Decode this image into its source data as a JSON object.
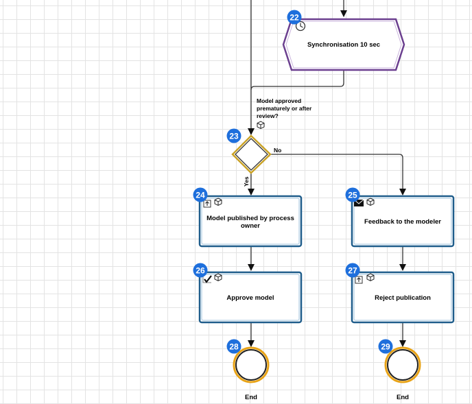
{
  "nodes": {
    "sync": {
      "number": "22",
      "label": "Synchronisation 10 sec",
      "icon": "clock-icon"
    },
    "gateway": {
      "number": "23",
      "label_lines": [
        "Model approved",
        "prematurely or after",
        "review?"
      ],
      "icon": "cube-icon"
    },
    "publish": {
      "number": "24",
      "label_lines": [
        "Model published by process",
        "owner"
      ],
      "icons": [
        "upload-icon",
        "cube-icon"
      ]
    },
    "feedback": {
      "number": "25",
      "label": "Feedback to the modeler",
      "icons": [
        "envelope-icon",
        "cube-icon"
      ]
    },
    "approve": {
      "number": "26",
      "label": "Approve model",
      "icons": [
        "check-icon",
        "cube-icon"
      ]
    },
    "reject": {
      "number": "27",
      "label": "Reject publication",
      "icons": [
        "upload-icon",
        "cube-icon"
      ]
    },
    "end_left": {
      "number": "28",
      "label": "End"
    },
    "end_right": {
      "number": "29",
      "label": "End"
    }
  },
  "edges": {
    "yes_label": "Yes",
    "no_label": "No"
  },
  "colors": {
    "badge": "#1e6fdc",
    "task_border": "#1f5d8b",
    "sync_border": "#6b3f8f",
    "gateway_border": "#c9a227",
    "end_border": "#e8a317"
  }
}
